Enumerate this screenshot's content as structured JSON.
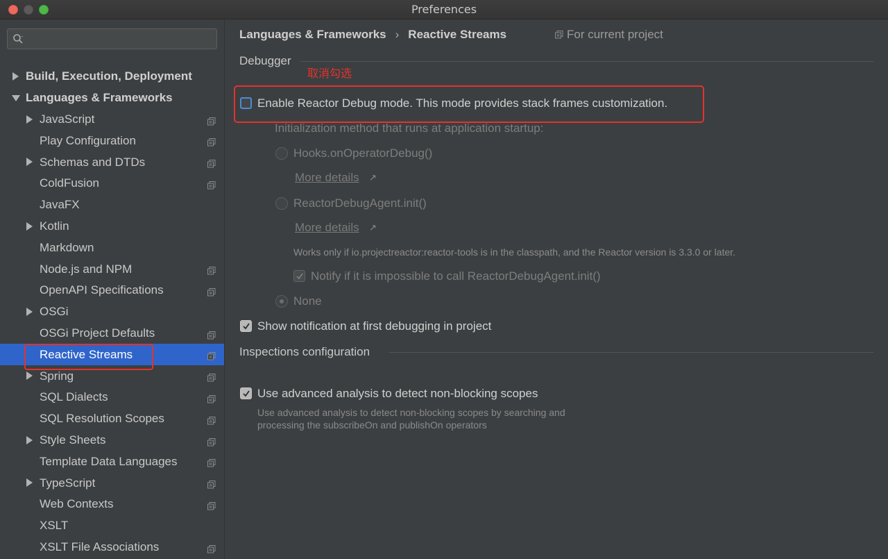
{
  "window": {
    "title": "Preferences"
  },
  "search": {
    "placeholder": ""
  },
  "sidebar": {
    "items": [
      {
        "label": "Build, Execution, Deployment",
        "expander": "right",
        "level": 0,
        "proj": false
      },
      {
        "label": "Languages & Frameworks",
        "expander": "down",
        "level": 0,
        "proj": false
      },
      {
        "label": "JavaScript",
        "expander": "right",
        "level": 1,
        "proj": true
      },
      {
        "label": "Play Configuration",
        "expander": "",
        "level": 1,
        "proj": true
      },
      {
        "label": "Schemas and DTDs",
        "expander": "right",
        "level": 1,
        "proj": true
      },
      {
        "label": "ColdFusion",
        "expander": "",
        "level": 1,
        "proj": true
      },
      {
        "label": "JavaFX",
        "expander": "",
        "level": 1,
        "proj": false
      },
      {
        "label": "Kotlin",
        "expander": "right",
        "level": 1,
        "proj": false
      },
      {
        "label": "Markdown",
        "expander": "",
        "level": 1,
        "proj": false
      },
      {
        "label": "Node.js and NPM",
        "expander": "",
        "level": 1,
        "proj": true
      },
      {
        "label": "OpenAPI Specifications",
        "expander": "",
        "level": 1,
        "proj": true
      },
      {
        "label": "OSGi",
        "expander": "right",
        "level": 1,
        "proj": false
      },
      {
        "label": "OSGi Project Defaults",
        "expander": "",
        "level": 1,
        "proj": true
      },
      {
        "label": "Reactive Streams",
        "expander": "",
        "level": 1,
        "proj": true,
        "selected": true
      },
      {
        "label": "Spring",
        "expander": "right",
        "level": 1,
        "proj": true
      },
      {
        "label": "SQL Dialects",
        "expander": "",
        "level": 1,
        "proj": true
      },
      {
        "label": "SQL Resolution Scopes",
        "expander": "",
        "level": 1,
        "proj": true
      },
      {
        "label": "Style Sheets",
        "expander": "right",
        "level": 1,
        "proj": true
      },
      {
        "label": "Template Data Languages",
        "expander": "",
        "level": 1,
        "proj": true
      },
      {
        "label": "TypeScript",
        "expander": "right",
        "level": 1,
        "proj": true
      },
      {
        "label": "Web Contexts",
        "expander": "",
        "level": 1,
        "proj": true
      },
      {
        "label": "XSLT",
        "expander": "",
        "level": 1,
        "proj": false
      },
      {
        "label": "XSLT File Associations",
        "expander": "",
        "level": 1,
        "proj": true
      }
    ]
  },
  "main": {
    "breadcrumb": {
      "parent": "Languages & Frameworks",
      "separator": "›",
      "current": "Reactive Streams"
    },
    "for_project": "For current project",
    "debugger": {
      "section_title": "Debugger",
      "annotation": "取消勾选",
      "enable_label": "Enable Reactor Debug mode. This mode provides stack frames customization.",
      "init_method_label": "Initialization method that runs at application startup:",
      "option_hooks": "Hooks.onOperatorDebug()",
      "more_details_1": "More details",
      "option_agent": "ReactorDebugAgent.init()",
      "more_details_2": "More details",
      "agent_note": "Works only if io.projectreactor:reactor-tools is in the classpath, and the Reactor version is 3.3.0 or later.",
      "notify_label": "Notify if it is impossible to call ReactorDebugAgent.init()",
      "option_none": "None",
      "show_notification_label": "Show notification at first debugging in project"
    },
    "inspections": {
      "section_title": "Inspections configuration",
      "advanced_label": "Use advanced analysis to detect non-blocking scopes",
      "advanced_desc_1": "Use advanced analysis to detect non-blocking scopes by searching and",
      "advanced_desc_2": "processing the subscribeOn and publishOn operators"
    }
  },
  "colors": {
    "accent": "#2f65ca",
    "annotation_red": "#e2332d",
    "background": "#3c3f41"
  }
}
